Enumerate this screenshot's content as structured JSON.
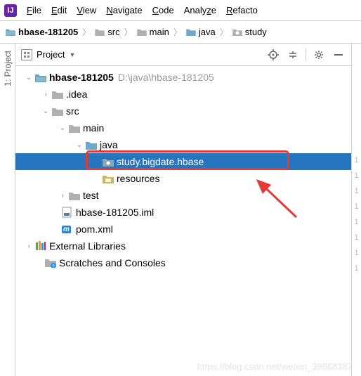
{
  "menu": {
    "items": [
      "File",
      "Edit",
      "View",
      "Navigate",
      "Code",
      "Analyze",
      "Refacto"
    ]
  },
  "breadcrumb": {
    "items": [
      "hbase-181205",
      "src",
      "main",
      "java",
      "study"
    ]
  },
  "sidebar_tab": "1: Project",
  "panel": {
    "title": "Project"
  },
  "tree": {
    "root": {
      "name": "hbase-181205",
      "path": "D:\\java\\hbase-181205"
    },
    "idea": ".idea",
    "src": "src",
    "main": "main",
    "java": "java",
    "pkg": "study.bigdate.hbase",
    "resources": "resources",
    "test": "test",
    "iml": "hbase-181205.iml",
    "pom": "pom.xml",
    "ext": "External Libraries",
    "scratch": "Scratches and Consoles"
  },
  "gutter": [
    "1",
    "1",
    "1",
    "1",
    "1",
    "1",
    "1",
    "1"
  ],
  "watermark": "https://blog.csdn.net/weixin_39868387"
}
